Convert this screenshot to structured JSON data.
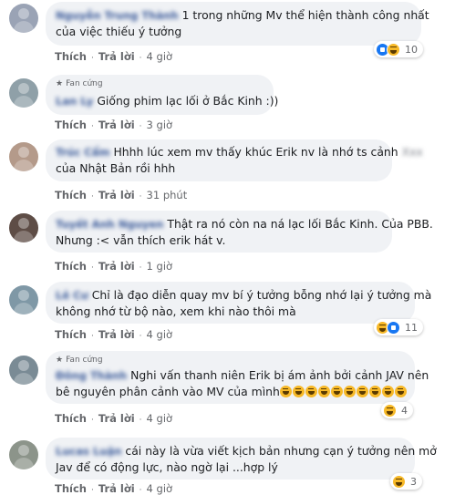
{
  "actions": {
    "like": "Thích",
    "reply": "Trả lời",
    "sep": "·"
  },
  "fan_badge": "Fan cứng",
  "comments": [
    {
      "name": "Nguyễn Trung Thành",
      "text1": "1 trong những Mv thể hiện thành công nhất",
      "text2": "của việc thiếu ý tưởng",
      "time": "4 giờ",
      "reactions": {
        "count": "10",
        "types": [
          "like-icon",
          "haha-icon"
        ]
      }
    },
    {
      "name": "Lan Ly",
      "fan": true,
      "text1": "Giống phim lạc lối ở Bắc Kinh :))",
      "time": "3 giờ"
    },
    {
      "name": "Trúc Cẩm",
      "text1": "Hhhh lúc xem mv thấy khúc Erik nv là nhớ ts cảnh",
      "blur1": "Xxx",
      "text2": "của Nhật Bản rồi hhh",
      "time": "31 phút"
    },
    {
      "name": "Tuyết Anh Nguyen",
      "text1": "Thật ra nó còn na ná lạc lối Bắc Kinh. Của PBB.",
      "text2": "Nhưng :< vẫn thích erik hát v.",
      "time": "1 giờ"
    },
    {
      "name": "Lê Cư",
      "text1": "Chỉ là đạo diễn quay mv bí ý tưởng bỗng nhớ lại ý tưởng mà",
      "text2": "không nhớ từ bộ nào, xem khi nào thôi mà",
      "time": "4 giờ",
      "reactions": {
        "count": "11",
        "types": [
          "haha-icon",
          "like-icon"
        ]
      }
    },
    {
      "name": "Đông Thành",
      "fan": true,
      "text1": "Nghi vấn thanh niên Erik bị ám ảnh bởi cảnh JAV nên",
      "text2": "bê nguyên phân cảnh vào MV của mình",
      "time": "4 giờ",
      "reactions": {
        "count": "4",
        "types": [
          "haha-icon"
        ]
      }
    },
    {
      "name": "Lucas Luận",
      "text1": "cái này là vừa viết kịch bản nhưng cạn ý tưởng nên mở",
      "text2": "Jav để có động lực, nào ngờ lại ...hợp lý",
      "time": "4 giờ",
      "reactions": {
        "count": "3",
        "types": [
          "haha-icon"
        ]
      }
    }
  ],
  "colors": {
    "bubble": "#f0f2f5",
    "name": "#385898",
    "meta": "#65676b",
    "like": "#1877f2",
    "haha": "#f7b928"
  }
}
